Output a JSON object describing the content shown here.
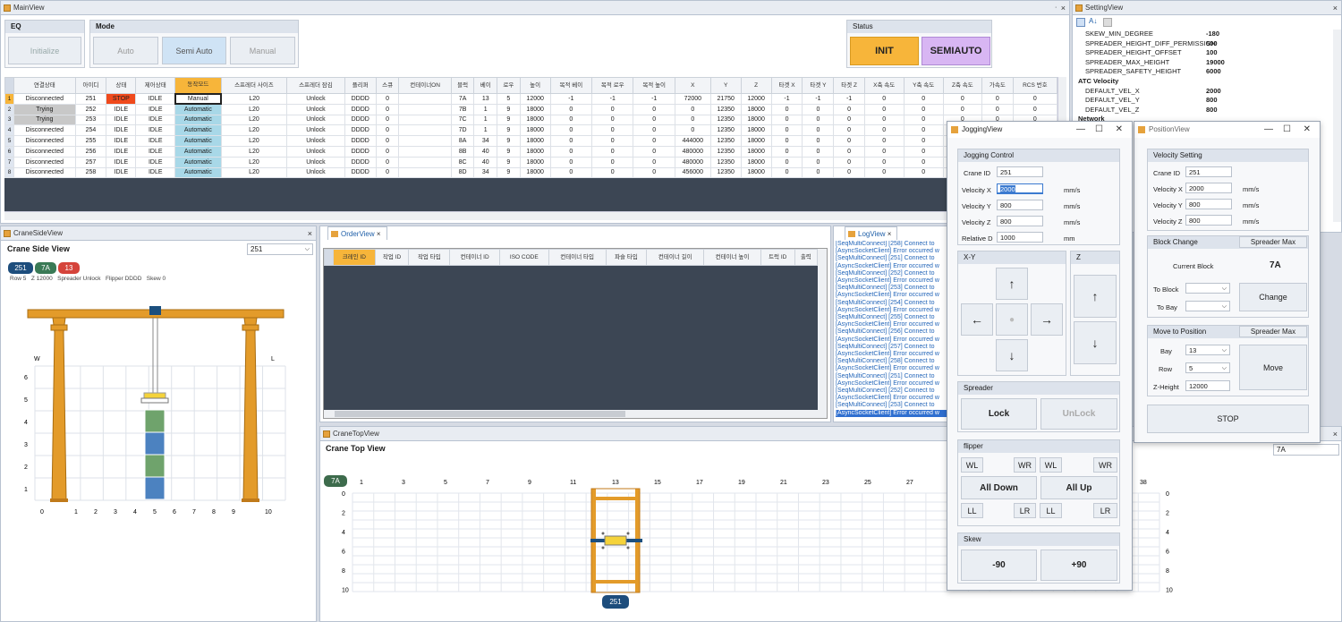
{
  "main": {
    "title": "MainView",
    "eq_label": "EQ",
    "initialize": "Initialize",
    "mode_label": "Mode",
    "auto": "Auto",
    "semi_auto": "Semi Auto",
    "manual": "Manual",
    "status_label": "Status",
    "init": "INIT",
    "semiauto": "SEMIAUTO"
  },
  "grid": {
    "headers": [
      "연결상태",
      "아이디",
      "상태",
      "제어상태",
      "동작모드",
      "스프레더 사이즈",
      "스프레더 잠김",
      "플리퍼",
      "스큐",
      "컨테이너ON",
      "블럭",
      "베이",
      "로우",
      "높이",
      "목적 베이",
      "목적 로우",
      "목적 높이",
      "X",
      "Y",
      "Z",
      "타겟 X",
      "타겟 Y",
      "타겟 Z",
      "X축 속도",
      "Y축 속도",
      "Z축 속도",
      "가속도",
      "RCS 번호"
    ],
    "rows": [
      [
        "1",
        "Disconnected",
        "251",
        "STOP",
        "IDLE",
        "Manual",
        "L20",
        "Unlock",
        "DDDD",
        "0",
        "",
        "7A",
        "13",
        "5",
        "12000",
        "-1",
        "-1",
        "-1",
        "72000",
        "21750",
        "12000",
        "-1",
        "-1",
        "-1",
        "0",
        "0",
        "0",
        "0",
        "0"
      ],
      [
        "2",
        "Trying",
        "252",
        "IDLE",
        "IDLE",
        "Automatic",
        "L20",
        "Unlock",
        "DDDD",
        "0",
        "",
        "7B",
        "1",
        "9",
        "18000",
        "0",
        "0",
        "0",
        "0",
        "12350",
        "18000",
        "0",
        "0",
        "0",
        "0",
        "0",
        "0",
        "0",
        "0"
      ],
      [
        "3",
        "Trying",
        "253",
        "IDLE",
        "IDLE",
        "Automatic",
        "L20",
        "Unlock",
        "DDDD",
        "0",
        "",
        "7C",
        "1",
        "9",
        "18000",
        "0",
        "0",
        "0",
        "0",
        "12350",
        "18000",
        "0",
        "0",
        "0",
        "0",
        "0",
        "0",
        "0",
        "0"
      ],
      [
        "4",
        "Disconnected",
        "254",
        "IDLE",
        "IDLE",
        "Automatic",
        "L20",
        "Unlock",
        "DDDD",
        "0",
        "",
        "7D",
        "1",
        "9",
        "18000",
        "0",
        "0",
        "0",
        "0",
        "12350",
        "18000",
        "0",
        "0",
        "0",
        "0",
        "0",
        "0",
        "0",
        "0"
      ],
      [
        "5",
        "Disconnected",
        "255",
        "IDLE",
        "IDLE",
        "Automatic",
        "L20",
        "Unlock",
        "DDDD",
        "0",
        "",
        "8A",
        "34",
        "9",
        "18000",
        "0",
        "0",
        "0",
        "444000",
        "12350",
        "18000",
        "0",
        "0",
        "0",
        "0",
        "0",
        "0",
        "0",
        "0"
      ],
      [
        "6",
        "Disconnected",
        "256",
        "IDLE",
        "IDLE",
        "Automatic",
        "L20",
        "Unlock",
        "DDDD",
        "0",
        "",
        "8B",
        "40",
        "9",
        "18000",
        "0",
        "0",
        "0",
        "480000",
        "12350",
        "18000",
        "0",
        "0",
        "0",
        "0",
        "0",
        "0",
        "0",
        "0"
      ],
      [
        "7",
        "Disconnected",
        "257",
        "IDLE",
        "IDLE",
        "Automatic",
        "L20",
        "Unlock",
        "DDDD",
        "0",
        "",
        "8C",
        "40",
        "9",
        "18000",
        "0",
        "0",
        "0",
        "480000",
        "12350",
        "18000",
        "0",
        "0",
        "0",
        "0",
        "0",
        "0",
        "0",
        "0"
      ],
      [
        "8",
        "Disconnected",
        "258",
        "IDLE",
        "IDLE",
        "Automatic",
        "L20",
        "Unlock",
        "DDDD",
        "0",
        "",
        "8D",
        "34",
        "9",
        "18000",
        "0",
        "0",
        "0",
        "456000",
        "12350",
        "18000",
        "0",
        "0",
        "0",
        "0",
        "0",
        "0",
        "0",
        "0"
      ]
    ]
  },
  "setting": {
    "title": "SettingView",
    "rows": [
      [
        "SKEW_MIN_DEGREE",
        "-180"
      ],
      [
        "SPREADER_HEIGHT_DIFF_PERMISSION",
        "500"
      ],
      [
        "SPREADER_HEIGHT_OFFSET",
        "100"
      ],
      [
        "SPREADER_MAX_HEIGHT",
        "19000"
      ],
      [
        "SPREADER_SAFETY_HEIGHT",
        "6000"
      ]
    ],
    "cat_velocity": "ATC Velocity",
    "vel_rows": [
      [
        "DEFAULT_VEL_X",
        "2000"
      ],
      [
        "DEFAULT_VEL_Y",
        "800"
      ],
      [
        "DEFAULT_VEL_Z",
        "800"
      ]
    ],
    "cat_network": "Network"
  },
  "side": {
    "title": "CraneSideView",
    "heading": "Crane Side View",
    "select": "251",
    "badges": [
      "251",
      "7A",
      "13"
    ],
    "info": "Row 5   Z 12000   Spreader Unlock   Flipper DDDD   Skew 0",
    "w": "W",
    "l": "L",
    "yticks": [
      "6",
      "5",
      "4",
      "3",
      "2",
      "1"
    ],
    "xticks": [
      "0",
      "1",
      "2",
      "3",
      "4",
      "5",
      "6",
      "7",
      "8",
      "9",
      "10"
    ]
  },
  "order": {
    "title": "OrderView",
    "headers": [
      "크레인 ID",
      "작업 ID",
      "작업 타입",
      "컨테이너 ID",
      "ISO CODE",
      "컨테이너 타입",
      "파슬 타입",
      "컨테이너 길이",
      "컨테이너 높이",
      "트럭 ID",
      "출력"
    ]
  },
  "log": {
    "title": "LogView",
    "lines": [
      "[SeqMultiConnect] [258] Connect to",
      "[AsyncSocketClient] Error occurred w",
      "[SeqMultiConnect] [251] Connect to",
      "[AsyncSocketClient] Error occurred w",
      "[SeqMultiConnect] [252] Connect to",
      "[AsyncSocketClient] Error occurred w",
      "[SeqMultiConnect] [253] Connect to",
      "[AsyncSocketClient] Error occurred w",
      "[SeqMultiConnect] [254] Connect to",
      "[AsyncSocketClient] Error occurred w",
      "[SeqMultiConnect] [255] Connect to",
      "[AsyncSocketClient] Error occurred w",
      "[SeqMultiConnect] [256] Connect to",
      "[AsyncSocketClient] Error occurred w",
      "[SeqMultiConnect] [257] Connect to",
      "[AsyncSocketClient] Error occurred w",
      "[SeqMultiConnect] [258] Connect to",
      "[AsyncSocketClient] Error occurred w",
      "[SeqMultiConnect] [251] Connect to",
      "[AsyncSocketClient] Error occurred w",
      "[SeqMultiConnect] [252] Connect to",
      "[AsyncSocketClient] Error occurred w",
      "[SeqMultiConnect] [253] Connect to",
      "[AsyncSocketClient] Error occurred w"
    ]
  },
  "top": {
    "title": "CraneTopView",
    "heading": "Crane Top View",
    "block": "7A",
    "xticks": [
      "1",
      "3",
      "5",
      "7",
      "9",
      "11",
      "13",
      "15",
      "17",
      "19",
      "21",
      "23",
      "25",
      "27"
    ],
    "last_tick": "38",
    "yticks": [
      "0",
      "2",
      "4",
      "6",
      "8",
      "10"
    ],
    "rticks": [
      "0",
      "2",
      "4",
      "6",
      "8",
      "10"
    ],
    "crane": "251",
    "right_select": "7A"
  },
  "jog": {
    "title": "JoggingView",
    "control": "Jogging Control",
    "crane_id_l": "Crane ID",
    "crane_id": "251",
    "vx_l": "Velocity X",
    "vx": "2000",
    "vy_l": "Velocity Y",
    "vy": "800",
    "vz_l": "Velocity Z",
    "vz": "800",
    "rd_l": "Relative D",
    "rd": "1000",
    "mms": "mm/s",
    "mm": "mm",
    "xy": "X-Y",
    "z": "Z",
    "up": "↑",
    "down": "↓",
    "left": "←",
    "right": "→",
    "spreader": "Spreader",
    "lock": "Lock",
    "unlock": "UnLock",
    "flipper": "flipper",
    "wl": "WL",
    "wr": "WR",
    "all_down": "All Down",
    "all_up": "All Up",
    "ll": "LL",
    "lr": "LR",
    "skew": "Skew",
    "m90": "-90",
    "p90": "+90"
  },
  "pos": {
    "title": "PositionView",
    "vel": "Velocity Setting",
    "crane_id_l": "Crane ID",
    "crane_id": "251",
    "vx_l": "Velocity X",
    "vx": "2000",
    "vy_l": "Velocity Y",
    "vy": "800",
    "vz_l": "Velocity Z",
    "vz": "800",
    "mms": "mm/s",
    "block_change": "Block Change",
    "spreader_max": "Spreader Max",
    "current_block_l": "Current Block",
    "current_block": "7A",
    "to_block": "To Block",
    "to_bay": "To Bay",
    "change": "Change",
    "move_to": "Move to Position",
    "bay_l": "Bay",
    "bay": "13",
    "row_l": "Row",
    "row": "5",
    "zh_l": "Z-Height",
    "zh": "12000",
    "move": "Move",
    "stop": "STOP"
  },
  "colors": {
    "stop": "#f04a1c",
    "trying": "#c8c8c8",
    "auto": "#a8d8e8",
    "init": "#f7b53a",
    "semiauto": "#d8b6f3",
    "crane": "#e39b2a"
  }
}
